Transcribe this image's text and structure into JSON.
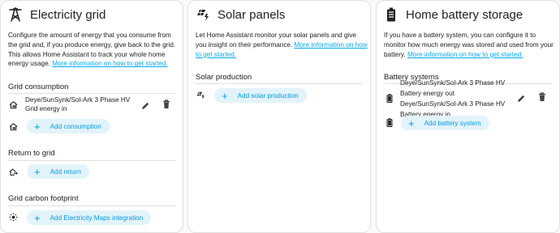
{
  "grid": {
    "title": "Electricity grid",
    "description": "Configure the amount of energy that you consume from the grid and, if you produce energy, give back to the grid. This allows Home Assistant to track your whole home energy usage.",
    "link": "More information on how to get started.",
    "consumption": {
      "heading": "Grid consumption",
      "entity": "Deye/SunSynk/Sol-Ark 3 Phase HV Grid energy in",
      "add_label": "Add consumption"
    },
    "return": {
      "heading": "Return to grid",
      "add_label": "Add return"
    },
    "carbon": {
      "heading": "Grid carbon footprint",
      "add_label": "Add Electricity Maps integration"
    }
  },
  "solar": {
    "title": "Solar panels",
    "description": "Let Home Assistant monitor your solar panels and give you insight on their performance.",
    "link": "More information on how to get started.",
    "production": {
      "heading": "Solar production",
      "add_label": "Add solar production"
    }
  },
  "battery": {
    "title": "Home battery storage",
    "description": "If you have a battery system, you can configure it to monitor how much energy was stored and used from your battery.",
    "link": "More information on how to get started.",
    "systems": {
      "heading": "Battery systems",
      "entity_out": "Deye/SunSynk/Sol-Ark 3 Phase HV Battery energy out",
      "entity_in": "Deye/SunSynk/Sol-Ark 3 Phase HV Battery energy in",
      "add_label": "Add battery system"
    }
  },
  "colors": {
    "accent": "#03a9f4",
    "button_bg": "#e3f3fb",
    "divider": "#e0e0e0",
    "icon": "#212121"
  }
}
